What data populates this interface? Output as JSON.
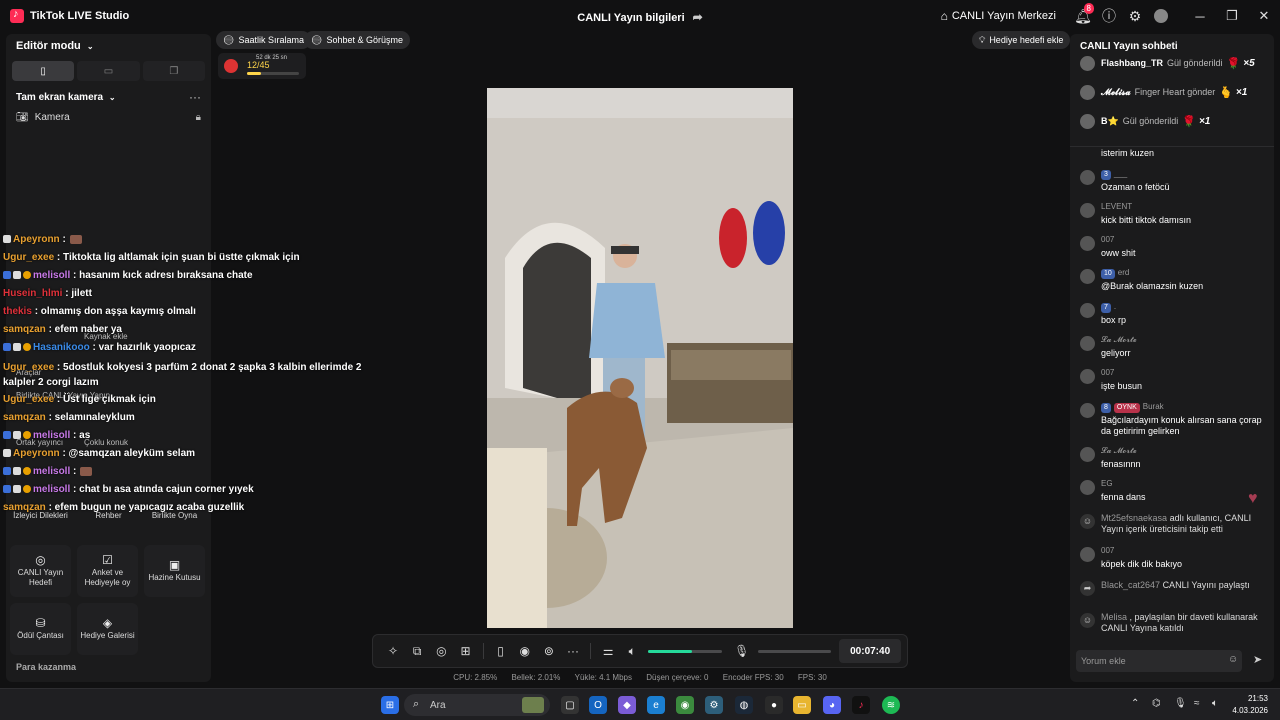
{
  "titlebar": {
    "app_name": "TikTok LIVE Studio",
    "center_title": "CANLI Yayın bilgileri",
    "live_center_label": "CANLI Yayın Merkezi",
    "notification_count": "8"
  },
  "left_panel": {
    "editor_mode": "Editör modu",
    "scene_label": "Tam ekran kamera",
    "camera_label": "Kamera",
    "ghost_add_source": "Kaynak ekle",
    "ghost_tools": "Araçlar",
    "ghost_collab": "Birlikte CANLI Yayın Yapın",
    "ghost_co_host": "Ortak yayıncı",
    "ghost_multi_guest": "Çoklu konuk",
    "tools": [
      {
        "label": "İzleyici Dilekleri",
        "icon": "wish-icon"
      },
      {
        "label": "Rehber",
        "icon": "guide-icon"
      },
      {
        "label": "Birlikte Oyna",
        "icon": "play-together-icon"
      },
      {
        "label": "CANLI Yayın Hedefi",
        "icon": "goal-icon"
      },
      {
        "label": "Anket ve Hediyeyle oy",
        "icon": "poll-icon"
      },
      {
        "label": "Hazine Kutusu",
        "icon": "treasure-icon"
      },
      {
        "label": "Ödül Çantası",
        "icon": "reward-bag-icon"
      },
      {
        "label": "Hediye Galerisi",
        "icon": "gift-gallery-icon"
      }
    ],
    "monetize_label": "Para kazanma"
  },
  "top_pills": {
    "hourly_ranking": "Saatlik Sıralama",
    "chat_meet": "Sohbet & Görüşme",
    "add_gift_goal": "Hediye hedefi ekle"
  },
  "gift_goal": {
    "count": "12/45",
    "time_left": "52 dk 25 sn",
    "progress": 0.27
  },
  "chat_overlay": [
    {
      "name": "Apeyronn",
      "color": "#e8a030",
      "text": ":"
    },
    {
      "name": "Ugur_exee",
      "color": "#e8a030",
      "text": ": Tiktokta lig altlamak için şuan bi üstte çıkmak için"
    },
    {
      "name": "melisoll",
      "color": "#c879e8",
      "text": ": hasanım kıck adresı bıraksana chate"
    },
    {
      "name": "Husein_hlmi",
      "color": "#e0313a",
      "text": ": jilett"
    },
    {
      "name": "thekis",
      "color": "#e0313a",
      "text": ": olmamış don aşşa kaymış olmalı"
    },
    {
      "name": "samqzan",
      "color": "#e8a030",
      "text": ": efem naber ya"
    },
    {
      "name": "Hasanikooo",
      "color": "#3a8be8",
      "text": ": var hazırlık yaopıcaz"
    },
    {
      "name": "Ugur_exee",
      "color": "#e8a030",
      "text": ": 5dostluk kokyesi 3 parfüm 2 donat 2 şapka 3 kalbin ellerimde 2 kalpler 2 corgi lazım"
    },
    {
      "name": "Ugur_exee",
      "color": "#e8a030",
      "text": ": Üst lige çıkmak için"
    },
    {
      "name": "samqzan",
      "color": "#e8a030",
      "text": ": selamınaleyklum"
    },
    {
      "name": "melisoll",
      "color": "#c879e8",
      "text": ": as"
    },
    {
      "name": "Apeyronn",
      "color": "#e8a030",
      "text": ": @samqzan aleyküm selam"
    },
    {
      "name": "melisoll",
      "color": "#c879e8",
      "text": ":"
    },
    {
      "name": "melisoll",
      "color": "#c879e8",
      "text": ": chat bı asa atında cajun corner yıyek"
    },
    {
      "name": "samqzan",
      "color": "#e8a030",
      "text": ": efem bugun ne yapıcagız acaba guzellik"
    }
  ],
  "controls": {
    "timer": "00:07:40",
    "volume_level": 0.6,
    "mic_level": 0.0
  },
  "status": {
    "cpu": "CPU: 2.85%",
    "memory": "Bellek: 2.01%",
    "upload": "Yükle: 4.1 Mbps",
    "dropped": "Düşen çerçeve: 0",
    "encoder_fps": "Encoder FPS: 30",
    "fps": "FPS: 30"
  },
  "right_panel": {
    "title": "CANLI Yayın sohbeti",
    "gifts": [
      {
        "name": "Flashbang_TR",
        "action": "Gül gönderildi",
        "count": "×5"
      },
      {
        "name": "𝓜𝓮𝓵𝓲𝓼𝓪",
        "action": "Finger Heart gönder",
        "count": "×1"
      },
      {
        "name": "B⭐",
        "action": "Gül gönderildi",
        "count": "×1"
      }
    ],
    "messages": [
      {
        "name": "",
        "level": "",
        "text": "isterim kuzen"
      },
      {
        "name": "___",
        "level": "3",
        "text": "Ozaman o fetöcü"
      },
      {
        "name": "LEVENT",
        "level": "",
        "text": "kick bitti tiktok damısın"
      },
      {
        "name": "007",
        "level": "",
        "text": "oww shit"
      },
      {
        "name": "erd",
        "level": "10",
        "text": "@Burak olamazsin kuzen"
      },
      {
        "name": ".",
        "level": "7",
        "text": "box rp"
      },
      {
        "name": "𝓛𝓪 𝓜𝓸𝓻𝓽𝓮",
        "level": "",
        "text": "geliyorr"
      },
      {
        "name": "007",
        "level": "",
        "text": "işte busun"
      },
      {
        "name": "Burak",
        "level": "8",
        "badge": "OYNK",
        "text": "Bağcılardayım konuk alırsan sana çorap da getiririm gelirken"
      },
      {
        "name": "𝓛𝓪 𝓜𝓸𝓻𝓽𝓮",
        "level": "",
        "text": "fenasınnn"
      },
      {
        "name": "EG",
        "level": "",
        "text": "fenna dans"
      }
    ],
    "system": [
      {
        "name": "Mt25efsnaekasa",
        "text": "adlı kullanıcı, CANLI Yayın içerik üreticisini takip etti"
      },
      {
        "name": "007",
        "text": "köpek dik dik bakıyo",
        "is_chat": true
      },
      {
        "name": "Black_cat2647",
        "text": "CANLI Yayını paylaştı"
      },
      {
        "name": "Melisa",
        "text": ", paylaşılan bir daveti kullanarak CANLI Yayına katıldı"
      }
    ],
    "comment_placeholder": "Yorum ekle"
  },
  "taskbar": {
    "search_placeholder": "Ara",
    "time": "21:53",
    "date": "4.03.2026"
  }
}
